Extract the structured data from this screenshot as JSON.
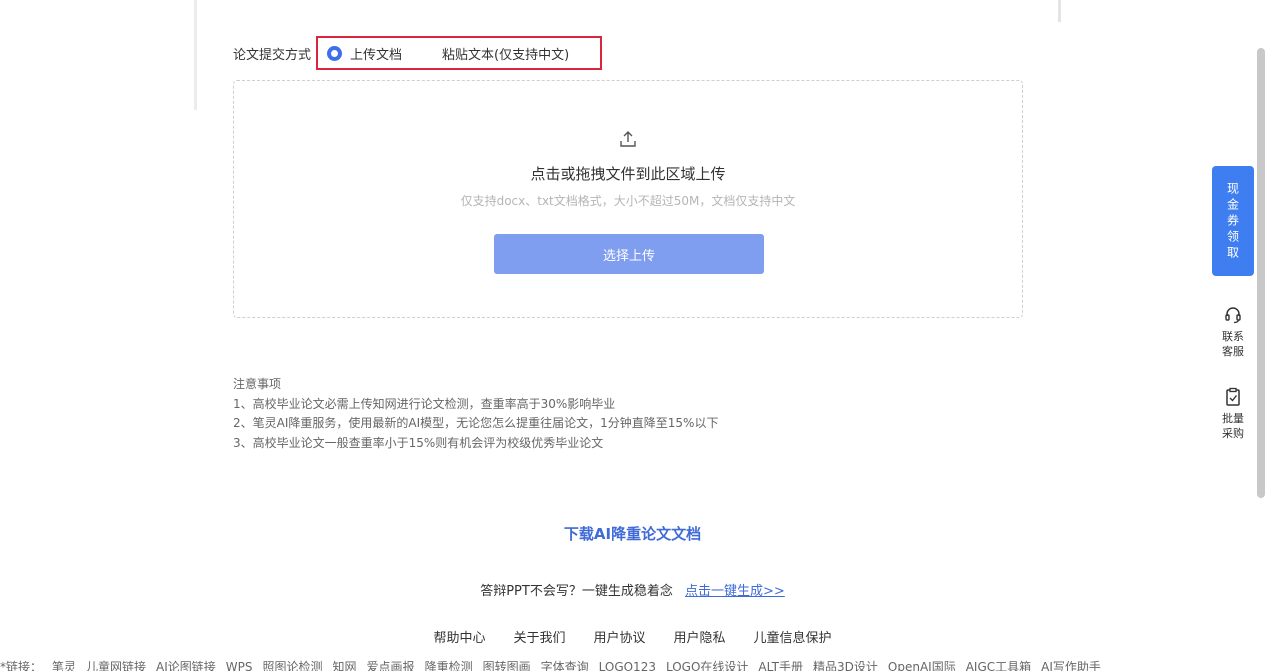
{
  "submission": {
    "label": "论文提交方式",
    "options": [
      {
        "label": "上传文档",
        "checked": true
      },
      {
        "label": "粘贴文本(仅支持中文)",
        "checked": false
      }
    ]
  },
  "upload": {
    "icon": "upload-icon",
    "title": "点击或拖拽文件到此区域上传",
    "hint": "仅支持docx、txt文档格式，大小不超过50M，文档仅支持中文",
    "button_label": "选择上传"
  },
  "notes": {
    "title": "注意事项",
    "items": [
      "1、高校毕业论文必需上传知网进行论文检测，查重率高于30%影响毕业",
      "2、笔灵AI降重服务，使用最新的AI模型，无论您怎么提重往届论文，1分钟直降至15%以下",
      "3、高校毕业论文一般查重率小于15%则有机会评为校级优秀毕业论文"
    ]
  },
  "download_link": "下载AI降重论文文档",
  "ppt_promo": {
    "text": "答辩PPT不会写？一键生成稳着念",
    "link": "点击一键生成>>"
  },
  "footer_links": [
    "帮助中心",
    "关于我们",
    "用户协议",
    "用户隐私",
    "儿童信息保护"
  ],
  "friend_links": [
    "*链接：",
    "笔灵",
    "儿童网链接",
    "AI论图链接",
    "WPS",
    "照图论检测",
    "知网",
    "爱点画报",
    "降重检测",
    "图转图画",
    "字体查询",
    "LOGO123",
    "LOGO在线设计",
    "ALT手册",
    "精品3D设计",
    "OpenAI国际",
    "AIGC工具箱",
    "AI写作助手"
  ],
  "float_panel": {
    "vip_label": "现金券领取",
    "contact": {
      "icon": "headset-icon",
      "label": "联系客服"
    },
    "batch": {
      "icon": "clipboard-icon",
      "label": "批量采购"
    }
  },
  "colors": {
    "accent": "#3f7ef0",
    "highlight_border": "#d9263f",
    "button": "#7f9ef0",
    "link": "#3f6ad8"
  }
}
